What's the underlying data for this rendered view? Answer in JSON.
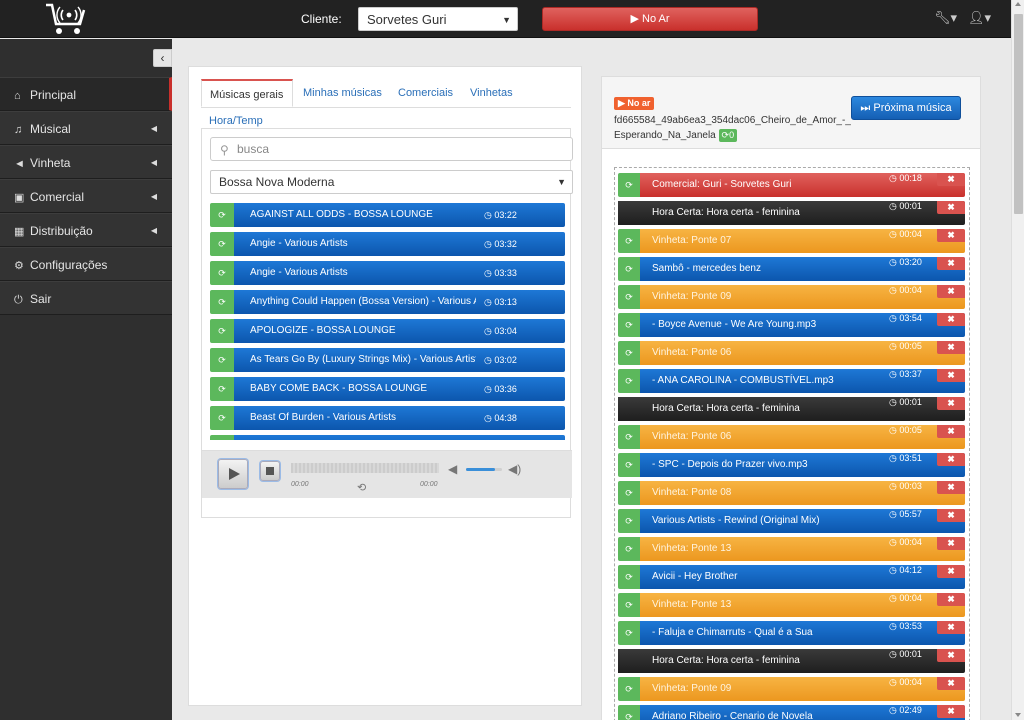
{
  "topbar": {
    "client_label": "Cliente:",
    "client_value": "Sorvetes Guri",
    "onair_label": "▶ No Ar"
  },
  "sidebar": {
    "items": [
      {
        "label": "Principal",
        "icon": "home-icon"
      },
      {
        "label": "Músical",
        "icon": "music-icon"
      },
      {
        "label": "Vinheta",
        "icon": "megaphone-icon"
      },
      {
        "label": "Comercial",
        "icon": "money-icon"
      },
      {
        "label": "Distribuição",
        "icon": "calendar-icon"
      },
      {
        "label": "Configurações",
        "icon": "gears-icon"
      },
      {
        "label": "Sair",
        "icon": "power-icon"
      }
    ]
  },
  "library": {
    "tabs": [
      "Músicas gerais",
      "Minhas músicas",
      "Comerciais",
      "Vinhetas",
      "Hora/Temp"
    ],
    "search_placeholder": "busca",
    "genre": "Bossa Nova Moderna",
    "tracks": [
      {
        "title": "AGAINST ALL ODDS - BOSSA LOUNGE",
        "duration": "03:22"
      },
      {
        "title": "Angie - Various Artists",
        "duration": "03:32"
      },
      {
        "title": "Angie - Various Artists",
        "duration": "03:33"
      },
      {
        "title": "Anything Could Happen (Bossa Version) - Various Artists",
        "duration": "03:13"
      },
      {
        "title": "APOLOGIZE - BOSSA LOUNGE",
        "duration": "03:04"
      },
      {
        "title": "As Tears Go By (Luxury Strings Mix) - Various Artists",
        "duration": "03:02"
      },
      {
        "title": "BABY COME BACK - BOSSA LOUNGE",
        "duration": "03:36"
      },
      {
        "title": "Beast Of Burden - Various Artists",
        "duration": "04:38"
      },
      {
        "title": "",
        "duration": ""
      }
    ],
    "player": {
      "time_start": "00:00",
      "time_end": "00:00",
      "volume": 0.8
    }
  },
  "queue": {
    "status": "▶ No ar",
    "now_playing": "fd665584_49ab6ea3_354dac06_Cheiro_de_Amor_-_Esperando_Na_Janela",
    "now_playing_badge": "0",
    "next_label": "Próxima música",
    "items": [
      {
        "color": "red",
        "title": "Comercial: Guri - Sorvetes Guri",
        "duration": "00:18"
      },
      {
        "color": "black",
        "title": "Hora Certa: Hora certa - feminina",
        "duration": "00:01"
      },
      {
        "color": "orange",
        "title": "Vinheta: Ponte 07",
        "duration": "00:04"
      },
      {
        "color": "blue",
        "title": "Sambô - mercedes benz",
        "duration": "03:20"
      },
      {
        "color": "orange",
        "title": "Vinheta: Ponte 09",
        "duration": "00:04"
      },
      {
        "color": "blue",
        "title": "- Boyce Avenue - We Are Young.mp3",
        "duration": "03:54"
      },
      {
        "color": "orange",
        "title": "Vinheta: Ponte 06",
        "duration": "00:05"
      },
      {
        "color": "blue",
        "title": "- ANA CAROLINA - COMBUSTÍVEL.mp3",
        "duration": "03:37"
      },
      {
        "color": "black",
        "title": "Hora Certa: Hora certa - feminina",
        "duration": "00:01"
      },
      {
        "color": "orange",
        "title": "Vinheta: Ponte 06",
        "duration": "00:05"
      },
      {
        "color": "blue",
        "title": "- SPC - Depois do Prazer vivo.mp3",
        "duration": "03:51"
      },
      {
        "color": "orange",
        "title": "Vinheta: Ponte 08",
        "duration": "00:03"
      },
      {
        "color": "blue",
        "title": "Various Artists - Rewind (Original Mix)",
        "duration": "05:57"
      },
      {
        "color": "orange",
        "title": "Vinheta: Ponte 13",
        "duration": "00:04"
      },
      {
        "color": "blue",
        "title": "Avicii - Hey Brother",
        "duration": "04:12"
      },
      {
        "color": "orange",
        "title": "Vinheta: Ponte 13",
        "duration": "00:04"
      },
      {
        "color": "blue",
        "title": "- Faluja e Chimarruts - Qual é a Sua",
        "duration": "03:53"
      },
      {
        "color": "black",
        "title": "Hora Certa: Hora certa - feminina",
        "duration": "00:01"
      },
      {
        "color": "orange",
        "title": "Vinheta: Ponte 09",
        "duration": "00:04"
      },
      {
        "color": "blue",
        "title": "Adriano Ribeiro - Cenario de Novela",
        "duration": "02:49"
      }
    ]
  }
}
